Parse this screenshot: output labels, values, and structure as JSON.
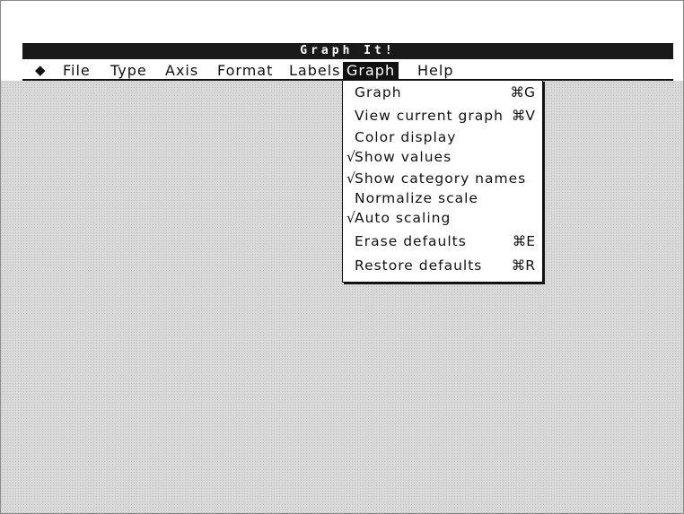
{
  "app": {
    "title": "Graph It!"
  },
  "menu_bar": {
    "apple_icon": "apple-icon",
    "items": [
      {
        "label": "File"
      },
      {
        "label": "Type"
      },
      {
        "label": "Axis"
      },
      {
        "label": "Format"
      },
      {
        "label": "Labels"
      },
      {
        "label": "Graph",
        "active": true
      },
      {
        "label": "Help"
      }
    ]
  },
  "graph_menu": {
    "items": [
      {
        "check": "",
        "label": "Graph",
        "shortcut": "⌘G"
      },
      {
        "check": "",
        "label": "View current graph",
        "shortcut": "⌘V"
      },
      {
        "check": "",
        "label": "Color display",
        "shortcut": ""
      },
      {
        "check": "√",
        "label": "Show values",
        "shortcut": ""
      },
      {
        "check": "√",
        "label": "Show category names",
        "shortcut": ""
      },
      {
        "check": "",
        "label": "Normalize scale",
        "shortcut": ""
      },
      {
        "check": "√",
        "label": "Auto scaling",
        "shortcut": ""
      },
      {
        "check": "",
        "label": "Erase defaults",
        "shortcut": "⌘E"
      },
      {
        "check": "",
        "label": "Restore defaults",
        "shortcut": "⌘R"
      }
    ]
  },
  "colors": {
    "menu_active_bg": "#111111",
    "desktop_pattern": "#d9d9d9"
  }
}
